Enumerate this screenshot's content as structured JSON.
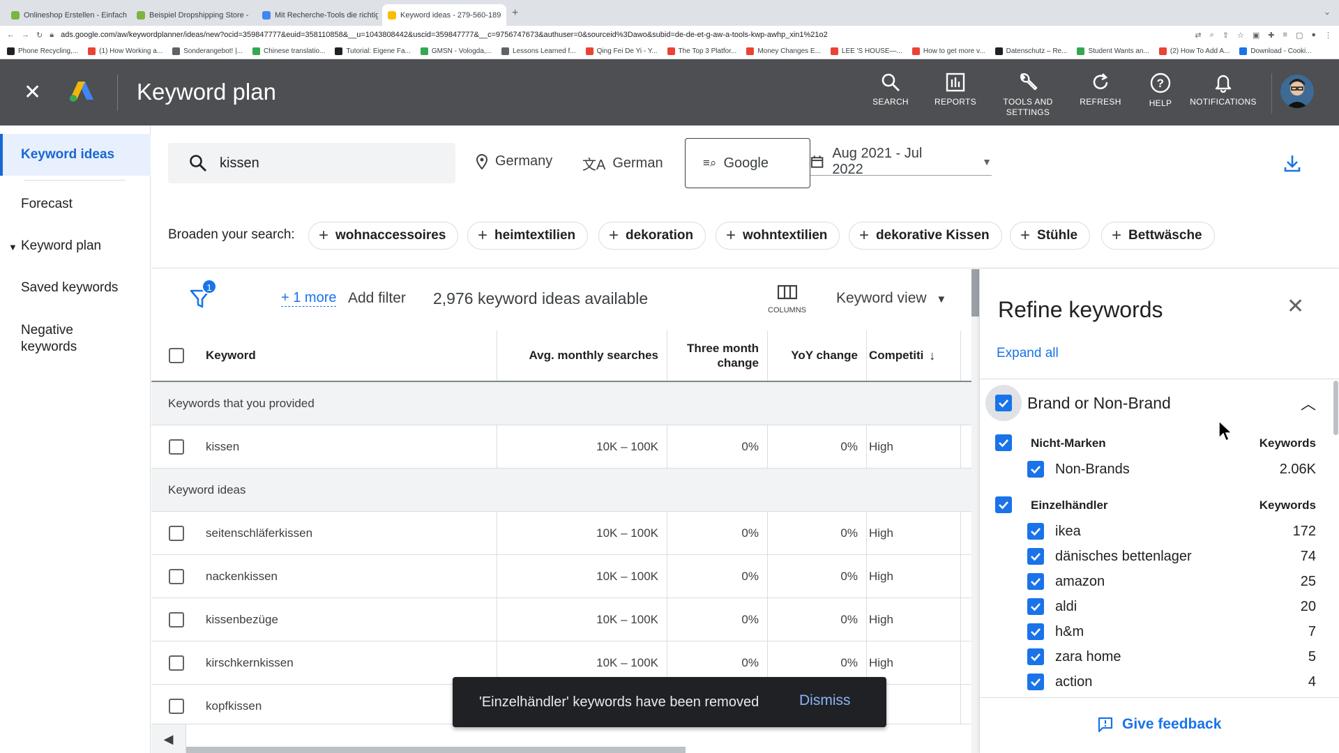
{
  "browser": {
    "tabs": [
      {
        "title": "Onlineshop Erstellen - Einfach",
        "color": "#7cb342"
      },
      {
        "title": "Beispiel Dropshipping Store -",
        "color": "#7cb342"
      },
      {
        "title": "Mit Recherche-Tools die richtig",
        "color": "#4285f4"
      },
      {
        "title": "Keyword ideas - 279-560-189",
        "color": "#fbbc04"
      }
    ],
    "url": "ads.google.com/aw/keywordplanner/ideas/new?ocid=359847777&euid=358110858&__u=1043808442&uscid=359847777&__c=9756747673&authuser=0&sourceid%3Dawo&subid=de-de-et-g-aw-a-tools-kwp-awhp_xin1%21o2",
    "bookmarks": [
      {
        "label": "Phone Recycling,...",
        "color": "#202124"
      },
      {
        "label": "(1) How Working a...",
        "color": "#ea4335"
      },
      {
        "label": "Sonderangebot! |...",
        "color": "#5f6368"
      },
      {
        "label": "Chinese translatio...",
        "color": "#34a853"
      },
      {
        "label": "Tutorial: Eigene Fa...",
        "color": "#202124"
      },
      {
        "label": "GMSN - Vologda,...",
        "color": "#34a853"
      },
      {
        "label": "Lessons Learned f...",
        "color": "#5f6368"
      },
      {
        "label": "Qing Fei De Yi - Y...",
        "color": "#ea4335"
      },
      {
        "label": "The Top 3 Platfor...",
        "color": "#ea4335"
      },
      {
        "label": "Money Changes E...",
        "color": "#ea4335"
      },
      {
        "label": "LEE 'S HOUSE—...",
        "color": "#ea4335"
      },
      {
        "label": "How to get more v...",
        "color": "#ea4335"
      },
      {
        "label": "Datenschutz – Re...",
        "color": "#202124"
      },
      {
        "label": "Student Wants an...",
        "color": "#34a853"
      },
      {
        "label": "(2) How To Add A...",
        "color": "#ea4335"
      },
      {
        "label": "Download - Cooki...",
        "color": "#1a73e8"
      }
    ]
  },
  "header": {
    "title": "Keyword plan",
    "tools": [
      {
        "label": "SEARCH",
        "icon": "search-icon"
      },
      {
        "label": "REPORTS",
        "icon": "reports-icon"
      },
      {
        "label": "TOOLS AND SETTINGS",
        "icon": "wrench-icon"
      },
      {
        "label": "REFRESH",
        "icon": "refresh-icon"
      },
      {
        "label": "HELP",
        "icon": "help-icon"
      },
      {
        "label": "NOTIFICATIONS",
        "icon": "bell-icon"
      }
    ]
  },
  "sidebar": {
    "items": [
      {
        "label": "Keyword ideas",
        "active": true
      },
      {
        "label": "Forecast"
      },
      {
        "label": "Keyword plan",
        "caret": true
      },
      {
        "label": "Saved keywords"
      },
      {
        "label": "Negative keywords"
      }
    ]
  },
  "toolbar": {
    "search_value": "kissen",
    "location": "Germany",
    "language": "German",
    "network": "Google",
    "date_range": "Aug 2021 - Jul 2022",
    "broaden_label": "Broaden your search:",
    "chips": [
      "wohnaccessoires",
      "heimtextilien",
      "dekoration",
      "wohntextilien",
      "dekorative Kissen",
      "Stühle",
      "Bettwäsche"
    ]
  },
  "filterbar": {
    "badge": "1",
    "more": "+ 1 more",
    "add_filter": "Add filter",
    "count_text": "2,976 keyword ideas available",
    "columns_label": "COLUMNS",
    "view_label": "Keyword view"
  },
  "table": {
    "columns": [
      "Keyword",
      "Avg. monthly searches",
      "Three month change",
      "YoY change",
      "Competiti"
    ],
    "group_provided": "Keywords that you provided",
    "provided_rows": [
      {
        "keyword": "kissen",
        "avg": "10K – 100K",
        "three": "0%",
        "yoy": "0%",
        "comp": "High"
      }
    ],
    "group_ideas": "Keyword ideas",
    "idea_rows": [
      {
        "keyword": "seitenschläferkissen",
        "avg": "10K – 100K",
        "three": "0%",
        "yoy": "0%",
        "comp": "High"
      },
      {
        "keyword": "nackenkissen",
        "avg": "10K – 100K",
        "three": "0%",
        "yoy": "0%",
        "comp": "High"
      },
      {
        "keyword": "kissenbezüge",
        "avg": "10K – 100K",
        "three": "0%",
        "yoy": "0%",
        "comp": "High"
      },
      {
        "keyword": "kirschkernkissen",
        "avg": "10K – 100K",
        "three": "0%",
        "yoy": "0%",
        "comp": "High"
      },
      {
        "keyword": "kopfkissen",
        "avg": "",
        "three": "",
        "yoy": "",
        "comp": "h"
      }
    ]
  },
  "refine": {
    "title": "Refine keywords",
    "expand_all": "Expand all",
    "section": "Brand or Non-Brand",
    "groups": [
      {
        "label": "Nicht-Marken",
        "kw_label": "Keywords",
        "items": [
          {
            "label": "Non-Brands",
            "count": "2.06K"
          }
        ]
      },
      {
        "label": "Einzelhändler",
        "kw_label": "Keywords",
        "items": [
          {
            "label": "ikea",
            "count": "172"
          },
          {
            "label": "dänisches bettenlager",
            "count": "74"
          },
          {
            "label": "amazon",
            "count": "25"
          },
          {
            "label": "aldi",
            "count": "20"
          },
          {
            "label": "h&m",
            "count": "7"
          },
          {
            "label": "zara home",
            "count": "5"
          },
          {
            "label": "action",
            "count": "4"
          }
        ]
      }
    ],
    "feedback": "Give feedback"
  },
  "toast": {
    "message": "'Einzelhändler' keywords have been removed",
    "dismiss": "Dismiss"
  }
}
